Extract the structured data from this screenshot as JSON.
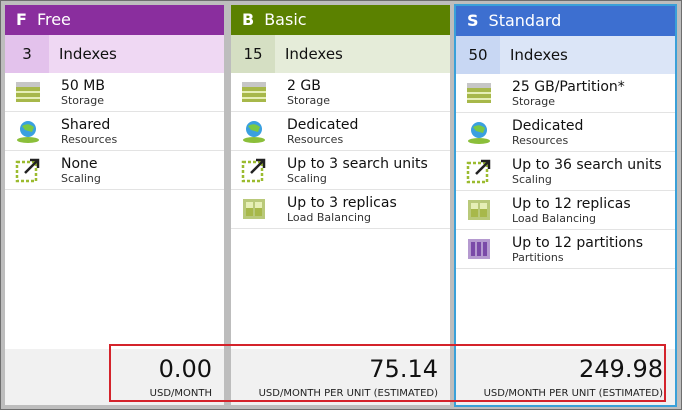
{
  "tiers": [
    {
      "key": "free",
      "letter": "F",
      "name": "Free",
      "index_count": "3",
      "index_label": "Indexes",
      "features": [
        {
          "icon": "storage-icon",
          "value": "50 MB",
          "label": "Storage"
        },
        {
          "icon": "globe-icon",
          "value": "Shared",
          "label": "Resources"
        },
        {
          "icon": "scaling-icon",
          "value": "None",
          "label": "Scaling"
        }
      ],
      "price": "0.00",
      "price_unit": "USD/MONTH",
      "color": "#8a2e9e"
    },
    {
      "key": "basic",
      "letter": "B",
      "name": "Basic",
      "index_count": "15",
      "index_label": "Indexes",
      "features": [
        {
          "icon": "storage-icon",
          "value": "2 GB",
          "label": "Storage"
        },
        {
          "icon": "globe-icon",
          "value": "Dedicated",
          "label": "Resources"
        },
        {
          "icon": "scaling-icon",
          "value": "Up to 3 search units",
          "label": "Scaling"
        },
        {
          "icon": "replicas-icon",
          "value": "Up to 3 replicas",
          "label": "Load Balancing"
        }
      ],
      "price": "75.14",
      "price_unit": "USD/MONTH PER UNIT (ESTIMATED)",
      "color": "#5b8100"
    },
    {
      "key": "standard",
      "letter": "S",
      "name": "Standard",
      "index_count": "50",
      "index_label": "Indexes",
      "features": [
        {
          "icon": "storage-icon",
          "value": "25 GB/Partition*",
          "label": "Storage"
        },
        {
          "icon": "globe-icon",
          "value": "Dedicated",
          "label": "Resources"
        },
        {
          "icon": "scaling-icon",
          "value": "Up to 36 search units",
          "label": "Scaling"
        },
        {
          "icon": "replicas-icon",
          "value": "Up to 12 replicas",
          "label": "Load Balancing"
        },
        {
          "icon": "partitions-icon",
          "value": "Up to 12 partitions",
          "label": "Partitions"
        }
      ],
      "price": "249.98",
      "price_unit": "USD/MONTH PER UNIT (ESTIMATED)",
      "color": "#3d6fd0"
    }
  ]
}
